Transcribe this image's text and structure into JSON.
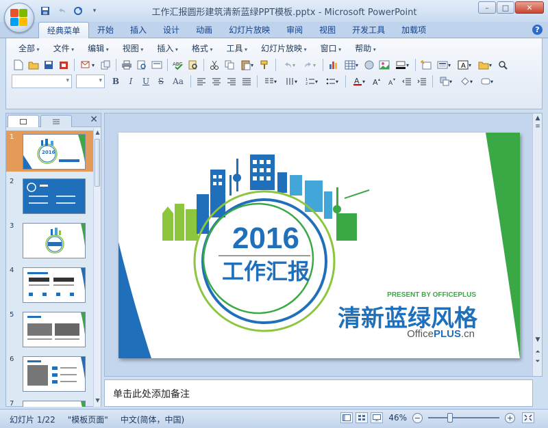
{
  "window": {
    "title": "工作汇报圆形建筑清新蓝绿PPT模板.pptx - Microsoft PowerPoint",
    "controls": {
      "minimize": "–",
      "maximize": "□",
      "close": "✕"
    }
  },
  "ribbon_tabs": [
    "经典菜单",
    "开始",
    "插入",
    "设计",
    "动画",
    "幻灯片放映",
    "审阅",
    "视图",
    "开发工具",
    "加载项"
  ],
  "menu": [
    "全部",
    "文件",
    "编辑",
    "视图",
    "插入",
    "格式",
    "工具",
    "幻灯片放映",
    "窗口",
    "帮助"
  ],
  "format_buttons": {
    "bold": "B",
    "italic": "I",
    "underline": "U",
    "strike": "S",
    "case": "Aa"
  },
  "help_label": "?",
  "slides_pane": {
    "close_label": "✕",
    "slide_numbers": [
      "1",
      "2",
      "3",
      "4",
      "5",
      "6",
      "7"
    ],
    "selected": 1
  },
  "slide": {
    "year": "2016",
    "subtitle": "工作汇报",
    "presenter": "PRESENT BY OFFICEPLUS",
    "headline": "清新蓝绿风格",
    "brand": {
      "part1": "Office",
      "part2": "PLUS",
      "part3": ".cn"
    }
  },
  "notes_placeholder": "单击此处添加备注",
  "status": {
    "slide_info": "幻灯片 1/22",
    "theme": "\"模板页面\"",
    "language": "中文(简体，中国)",
    "zoom": "46%",
    "zoom_minus": "−",
    "zoom_plus": "+"
  },
  "colors": {
    "blue": "#1f6fba",
    "green": "#39a845",
    "lightgreen": "#8cc63f",
    "selected": "#e59b58"
  }
}
